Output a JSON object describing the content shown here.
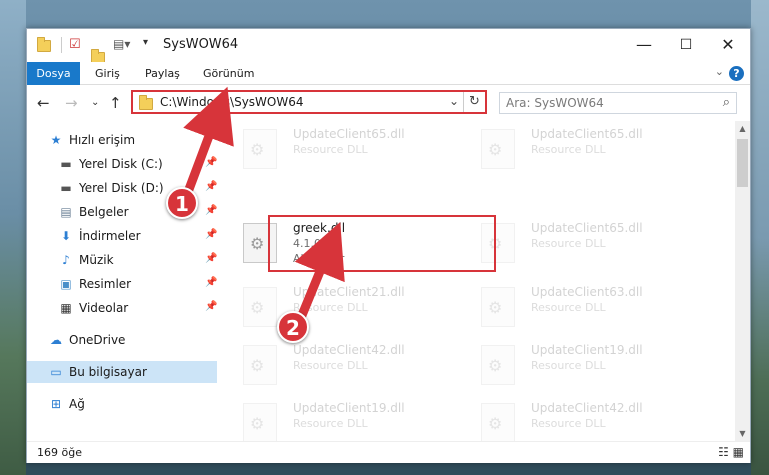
{
  "window": {
    "title": "SysWOW64",
    "controls": {
      "minimize": "—",
      "maximize": "☐",
      "close": "✕"
    }
  },
  "ribbon": {
    "tabs": [
      "Dosya",
      "Giriş",
      "Paylaş",
      "Görünüm"
    ],
    "help": "?"
  },
  "address": {
    "path": "C:\\Windows\\SysWOW64",
    "search_placeholder": "Ara: SysWOW64"
  },
  "sidebar": {
    "items": [
      {
        "label": "Hızlı erişim",
        "icon": "star-icon",
        "pinned": false
      },
      {
        "label": "Yerel Disk (C:)",
        "icon": "drive-icon",
        "pinned": true
      },
      {
        "label": "Yerel Disk (D:)",
        "icon": "drive-icon",
        "pinned": true
      },
      {
        "label": "Belgeler",
        "icon": "documents-icon",
        "pinned": true
      },
      {
        "label": "İndirmeler",
        "icon": "download-icon",
        "pinned": true
      },
      {
        "label": "Müzik",
        "icon": "music-icon",
        "pinned": true
      },
      {
        "label": "Resimler",
        "icon": "pictures-icon",
        "pinned": true
      },
      {
        "label": "Videolar",
        "icon": "video-icon",
        "pinned": true
      },
      {
        "label": "OneDrive",
        "icon": "cloud-icon",
        "pinned": false
      },
      {
        "label": "Bu bilgisayar",
        "icon": "computer-icon",
        "pinned": false
      },
      {
        "label": "Ağ",
        "icon": "network-icon",
        "pinned": false
      }
    ]
  },
  "files": {
    "ghost": [
      {
        "name": "UpdateClient65.dll",
        "desc": "Resource DLL"
      },
      {
        "name": "UpdateClient65.dll",
        "desc": "Resource DLL"
      },
      {
        "name": "UpdateClient65.dll",
        "desc": "Resource DLL"
      },
      {
        "name": "UpdateClient21.dll",
        "desc": "Resource DLL"
      },
      {
        "name": "UpdateClient63.dll",
        "desc": "Resource DLL"
      },
      {
        "name": "UpdateClient42.dll",
        "desc": "Resource DLL"
      },
      {
        "name": "UpdateClient19.dll",
        "desc": "Resource DLL"
      },
      {
        "name": "UpdateClient19.dll",
        "desc": "Resource DLL"
      },
      {
        "name": "UpdateClient42.dll",
        "desc": "Resource DLL"
      }
    ],
    "highlighted": {
      "name": "greek.dll",
      "version": "4.1.0.0",
      "company": "Alcohaler"
    }
  },
  "status": {
    "count": "169 öğe"
  },
  "annotations": {
    "step1": "1",
    "step2": "2",
    "color": "#d7343a"
  }
}
